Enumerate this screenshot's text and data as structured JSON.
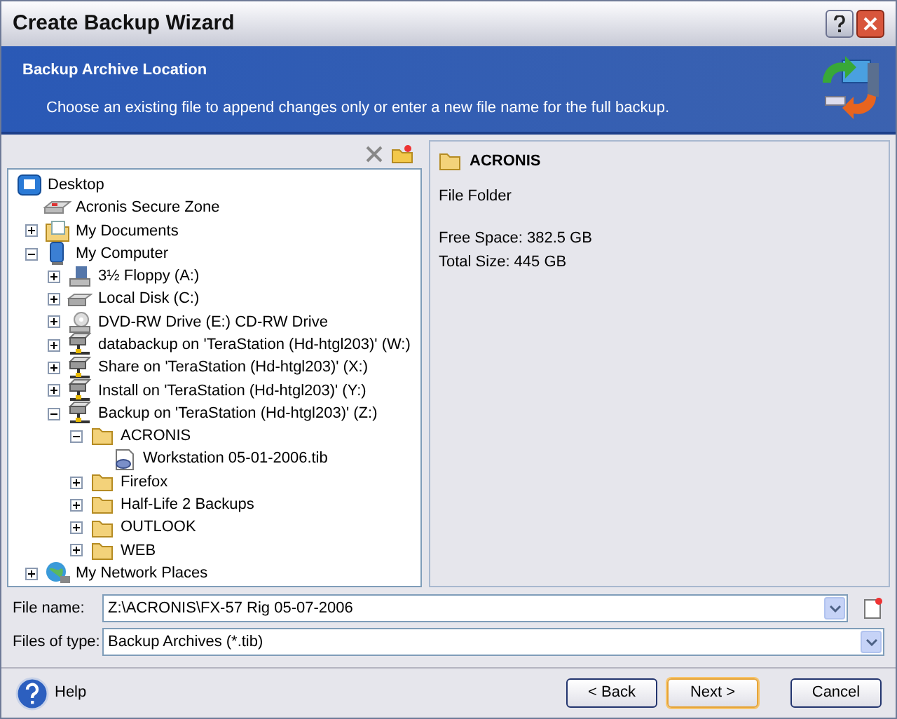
{
  "window": {
    "title": "Create Backup Wizard"
  },
  "header": {
    "title": "Backup Archive Location",
    "description": "Choose an existing file to append changes only or enter a new file name for the full backup."
  },
  "tree": [
    {
      "label": "Desktop",
      "kind": "desktop",
      "children": [
        {
          "label": "Acronis Secure Zone",
          "kind": "zone"
        },
        {
          "label": "My Documents",
          "kind": "documents",
          "expanded": false
        },
        {
          "label": "My Computer",
          "kind": "computer",
          "expanded": true,
          "children": [
            {
              "label": "3½ Floppy (A:)",
              "kind": "floppy",
              "expanded": false
            },
            {
              "label": "Local Disk (C:)",
              "kind": "disk",
              "expanded": false
            },
            {
              "label": "DVD-RW Drive (E:) CD-RW Drive",
              "kind": "dvd",
              "expanded": false
            },
            {
              "label": "databackup on 'TeraStation (Hd-htgl203)' (W:)",
              "kind": "netdrive",
              "expanded": false
            },
            {
              "label": "Share on 'TeraStation (Hd-htgl203)' (X:)",
              "kind": "netdrive",
              "expanded": false
            },
            {
              "label": "Install on 'TeraStation (Hd-htgl203)' (Y:)",
              "kind": "netdrive",
              "expanded": false
            },
            {
              "label": "Backup on 'TeraStation (Hd-htgl203)' (Z:)",
              "kind": "netdrive",
              "expanded": true,
              "children": [
                {
                  "label": "ACRONIS",
                  "kind": "folder",
                  "expanded": true,
                  "children": [
                    {
                      "label": "Workstation 05-01-2006.tib",
                      "kind": "archive"
                    }
                  ]
                },
                {
                  "label": "Firefox",
                  "kind": "folder",
                  "expanded": false
                },
                {
                  "label": "Half-Life 2 Backups",
                  "kind": "folder",
                  "expanded": false
                },
                {
                  "label": "OUTLOOK",
                  "kind": "folder",
                  "expanded": false
                },
                {
                  "label": "WEB",
                  "kind": "folder",
                  "expanded": false
                }
              ]
            }
          ]
        },
        {
          "label": "My Network Places",
          "kind": "network",
          "expanded": false
        }
      ]
    }
  ],
  "details": {
    "name": "ACRONIS",
    "type": "File Folder",
    "free_space": "Free Space: 382.5 GB",
    "total_size": "Total Size: 445 GB"
  },
  "file_name": {
    "label": "File name:",
    "value": "Z:\\ACRONIS\\FX-57 Rig 05-07-2006"
  },
  "file_type": {
    "label": "Files of type:",
    "value": "Backup Archives (*.tib)"
  },
  "help": "Help",
  "buttons": [
    {
      "label": "< Back",
      "focused": false
    },
    {
      "label": "Next >",
      "focused": true
    },
    {
      "label": "Cancel",
      "focused": false
    }
  ]
}
